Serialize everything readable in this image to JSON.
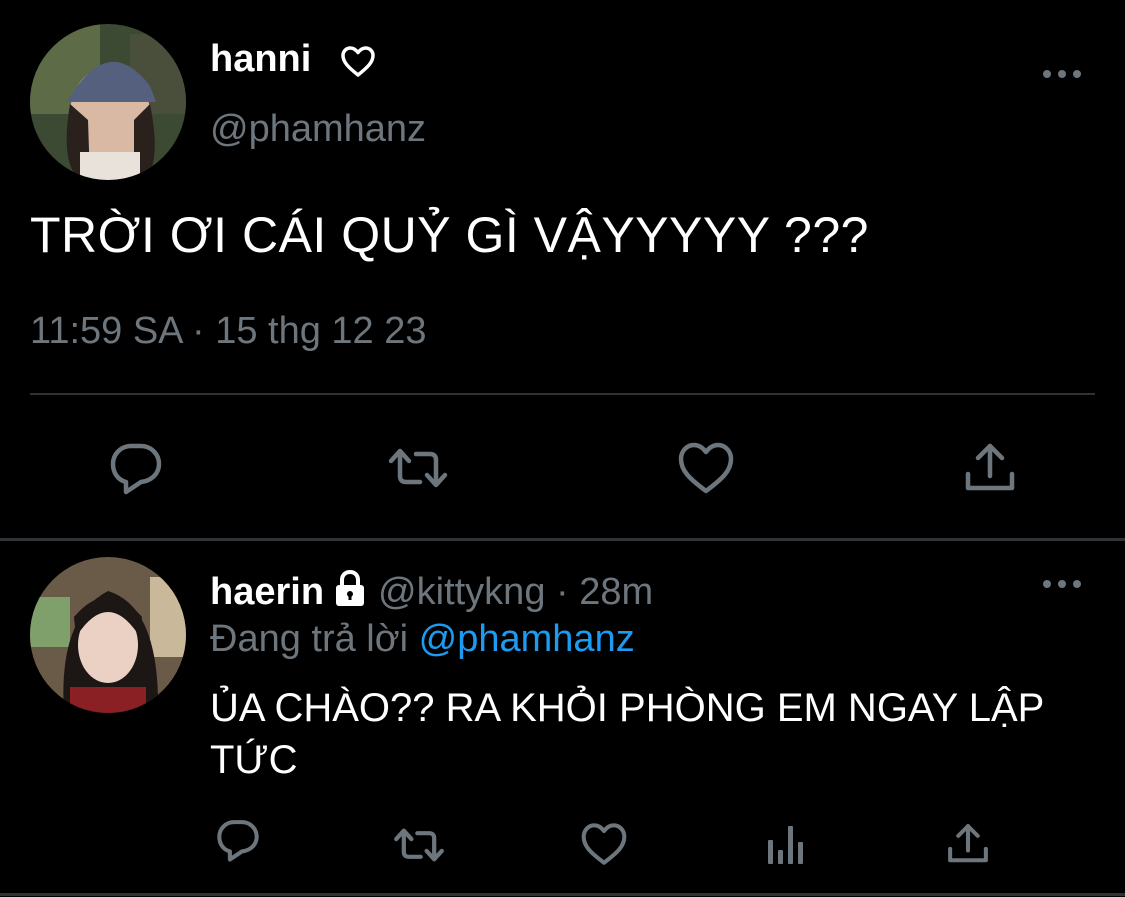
{
  "colors": {
    "background": "#000000",
    "text_primary": "#ffffff",
    "text_secondary": "#6e767d",
    "link": "#1d9bf0",
    "divider": "#2f3336",
    "icon": "#6e767d"
  },
  "main_tweet": {
    "display_name": "hanni",
    "name_badge_icon": "heart-outline-icon",
    "handle": "@phamhanz",
    "text": "TRỜI ƠI CÁI QUỶ GÌ VẬYYYYY ???",
    "timestamp": "11:59 SA · 15 thg 12 23",
    "more_icon": "more-dots-icon",
    "actions": [
      "reply-icon",
      "retweet-icon",
      "like-icon",
      "share-icon"
    ]
  },
  "reply_tweet": {
    "display_name": "haerin",
    "protected_icon": "lock-icon",
    "handle_time": "@kittykng · 28m",
    "replying_prefix": "Đang trả lời",
    "replying_to": "@phamhanz",
    "text": "ỦA CHÀO?? RA KHỎI PHÒNG EM NGAY LẬP TỨC",
    "more_icon": "more-dots-icon",
    "actions": [
      "reply-icon",
      "retweet-icon",
      "like-icon",
      "analytics-icon",
      "share-icon"
    ]
  }
}
